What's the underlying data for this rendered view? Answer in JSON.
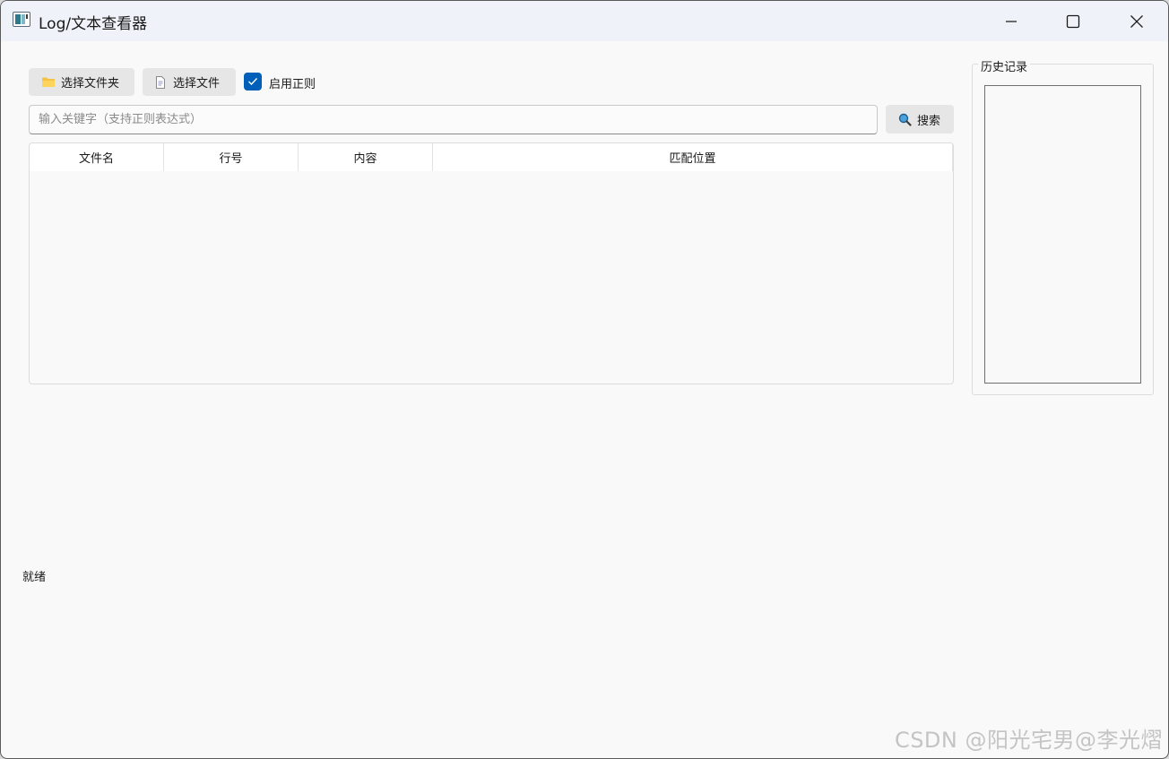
{
  "window": {
    "title": "Log/文本查看器"
  },
  "toolbar": {
    "select_folder_label": "选择文件夹",
    "select_file_label": "选择文件",
    "regex_checkbox_label": "启用正则",
    "regex_checked": true
  },
  "search": {
    "placeholder": "输入关键字（支持正则表达式）",
    "value": "",
    "button_label": "搜索"
  },
  "table": {
    "columns": [
      "文件名",
      "行号",
      "内容",
      "匹配位置"
    ],
    "rows": []
  },
  "history": {
    "title": "历史记录",
    "items": []
  },
  "status": {
    "text": "就绪"
  },
  "watermark": {
    "text": "CSDN @阳光宅男@李光熠"
  },
  "colors": {
    "accent": "#005fb8",
    "titlebar_bg": "#eff3f9",
    "window_bg": "#f9f9f9",
    "button_bg": "#e6e6e6",
    "folder_icon": "#f5c242"
  },
  "icons": {
    "app": "app-icon",
    "folder": "folder-icon",
    "file": "file-icon",
    "search": "magnifier-icon",
    "check": "check-icon",
    "minimize": "minimize-icon",
    "maximize": "maximize-icon",
    "close": "close-icon"
  }
}
